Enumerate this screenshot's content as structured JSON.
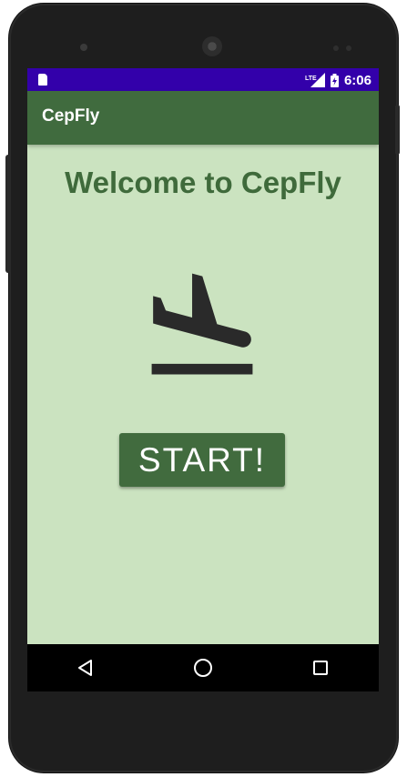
{
  "status_bar": {
    "time": "6:06",
    "network_label": "LTE",
    "colors": {
      "background": "#3300aa"
    },
    "icons": [
      "sim-card-icon",
      "lte-signal-icon",
      "battery-charging-icon"
    ]
  },
  "app_bar": {
    "title": "CepFly",
    "colors": {
      "background": "#406b3e",
      "text": "#ffffff"
    }
  },
  "main": {
    "welcome_text": "Welcome to CepFly",
    "hero_icon": "flight-land-icon",
    "start_button_label": "START!",
    "colors": {
      "background": "#cbe3c0",
      "accent": "#416b3e",
      "icon": "#2a2a2a"
    }
  },
  "nav_bar": {
    "icons": [
      "back-triangle-icon",
      "home-circle-icon",
      "recents-square-icon"
    ]
  }
}
